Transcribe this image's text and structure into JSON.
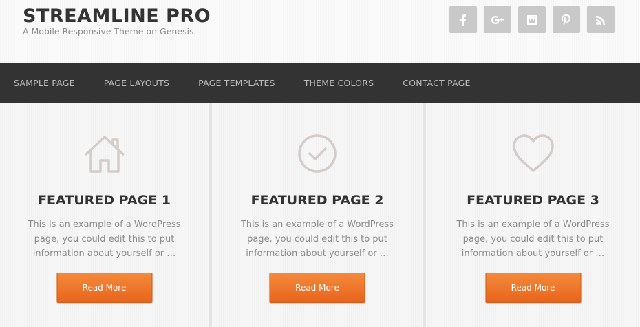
{
  "site": {
    "title": "STREAMLINE PRO",
    "description": "A Mobile Responsive Theme on Genesis"
  },
  "social": [
    {
      "icon": "facebook-icon"
    },
    {
      "icon": "google-plus-icon"
    },
    {
      "icon": "instagram-icon"
    },
    {
      "icon": "pinterest-icon"
    },
    {
      "icon": "rss-icon"
    }
  ],
  "nav": {
    "items": [
      {
        "label": "SAMPLE PAGE"
      },
      {
        "label": "PAGE LAYOUTS"
      },
      {
        "label": "PAGE TEMPLATES"
      },
      {
        "label": "THEME COLORS"
      },
      {
        "label": "CONTACT PAGE"
      }
    ]
  },
  "featured": [
    {
      "icon": "home-icon",
      "title": "FEATURED PAGE 1",
      "text": "This is an example of a WordPress page, you could edit this to put information about yourself or …",
      "button": "Read More"
    },
    {
      "icon": "check-circle-icon",
      "title": "FEATURED PAGE 2",
      "text": "This is an example of a WordPress page, you could edit this to put information about yourself or …",
      "button": "Read More"
    },
    {
      "icon": "heart-icon",
      "title": "FEATURED PAGE 3",
      "text": "This is an example of a WordPress page, you could edit this to put information about yourself or …",
      "button": "Read More"
    }
  ],
  "colors": {
    "accent": "#ef7a2c",
    "nav_bg": "#333333",
    "social_bg": "#c9c9c9",
    "icon_stroke": "#d4ccc8"
  }
}
